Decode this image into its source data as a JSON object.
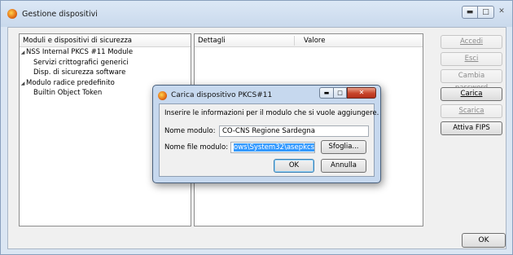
{
  "window": {
    "title": "Gestione dispositivi"
  },
  "tree": {
    "header": "Moduli e dispositivi di sicurezza",
    "items": [
      {
        "label": "NSS Internal PKCS #11 Module",
        "level": 0,
        "expanded": true
      },
      {
        "label": "Servizi crittografici generici",
        "level": 1
      },
      {
        "label": "Disp. di sicurezza software",
        "level": 1
      },
      {
        "label": "Modulo radice predefinito",
        "level": 0,
        "expanded": true
      },
      {
        "label": "Builtin Object Token",
        "level": 1
      }
    ]
  },
  "details": {
    "col_details": "Dettagli",
    "col_value": "Valore"
  },
  "buttons": {
    "login": "Accedi",
    "logout": "Esci",
    "change_password": "Cambia password",
    "load": "Carica",
    "unload": "Scarica",
    "enable_fips": "Attiva FIPS",
    "ok": "OK"
  },
  "dialog": {
    "title": "Carica dispositivo PKCS#11",
    "instruction": "Inserire le informazioni per il modulo che si vuole aggiungere.",
    "module_name_label": "Nome modulo:",
    "module_name_value": "CO-CNS Regione Sardegna",
    "module_file_label": "Nome file modulo:",
    "module_file_value": "ows\\System32\\asepkcs.dll",
    "browse": "Sfoglia...",
    "ok": "OK",
    "cancel": "Annulla"
  }
}
